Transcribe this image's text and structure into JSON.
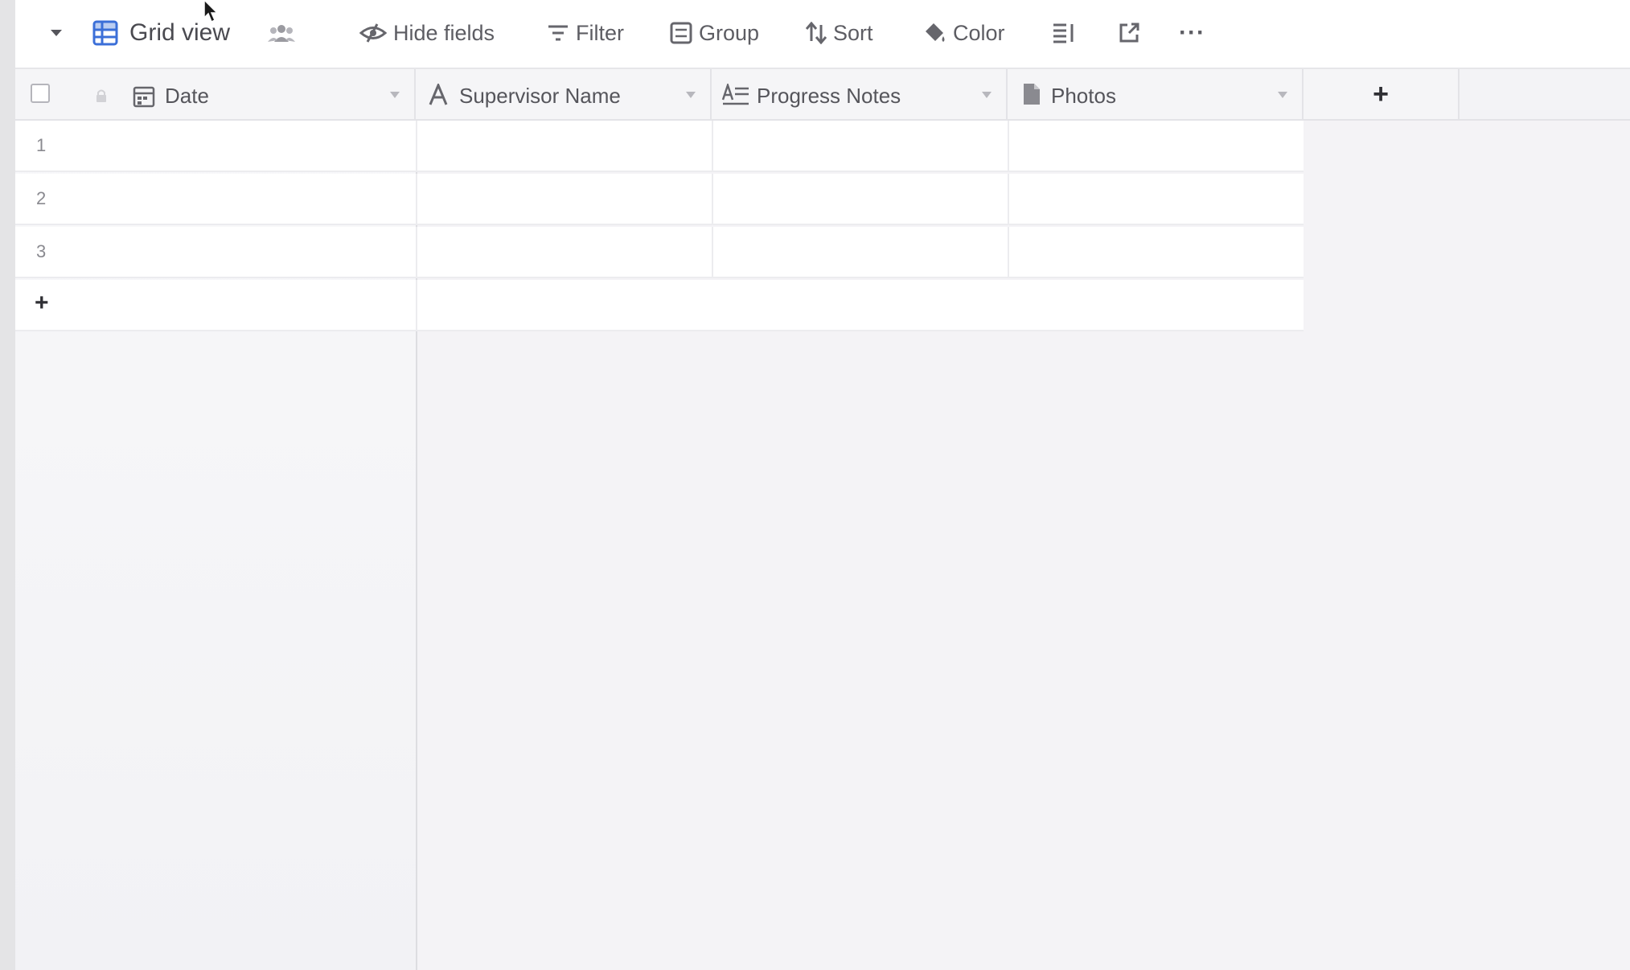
{
  "toolbar": {
    "view_name": "Grid view",
    "hide_fields": "Hide fields",
    "filter": "Filter",
    "group": "Group",
    "sort": "Sort",
    "color": "Color",
    "more": "···"
  },
  "grid": {
    "columns": [
      {
        "title": "Date",
        "icon": "calendar-icon"
      },
      {
        "title": "Supervisor Name",
        "icon": "text-icon"
      },
      {
        "title": "Progress Notes",
        "icon": "long-text-icon"
      },
      {
        "title": "Photos",
        "icon": "attachment-icon"
      }
    ],
    "add_column": "+",
    "rows": [
      {
        "number": "1"
      },
      {
        "number": "2"
      },
      {
        "number": "3"
      }
    ],
    "add_row": "+"
  },
  "colors": {
    "accent": "#3b6fd8",
    "background": "#f4f3f6",
    "header_bg": "#f5f5f7"
  }
}
